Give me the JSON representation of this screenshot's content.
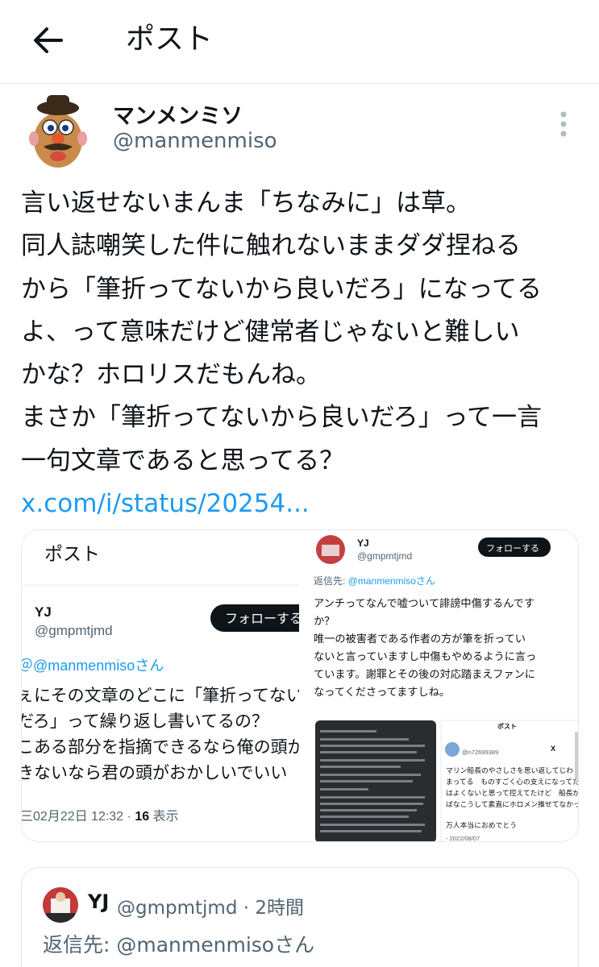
{
  "header": {
    "title": "ポスト",
    "back_icon": "arrow-left-icon"
  },
  "author": {
    "display_name": "マンメンミソ",
    "handle": "@manmenmiso",
    "more_icon": "more-vertical-icon"
  },
  "tweet": {
    "lines": [
      "言い返せないまんま「ちなみに」は草。",
      "同人誌嘲笑した件に触れないままダダ捏ねる",
      "から「筆折ってないから良いだろ」になってる",
      "よ、って意味だけど健常者じゃないと難しい",
      "かな？ホロリスだもんね。",
      "まさか「筆折ってないから良いだろ」って一言",
      "一句文章であると思ってる？"
    ],
    "link": "x.com/i/status/20254..."
  },
  "media": {
    "left": {
      "header_title": "ポスト",
      "name": "YJ",
      "handle": "@gmpmtjmd",
      "follow_label": "フォローする",
      "reply_to": "＠@manmenmisoさん",
      "body_lines": [
        "ぇにその文章のどこに「筆折ってない",
        "だろ」って繰り返し書いてるの？",
        "こある部分を指摘できるなら俺の頭が",
        "きないなら君の頭がおかしいでいい"
      ],
      "meta_time": "三02月22日 12:32 · ",
      "meta_views": "16",
      "meta_views_label": " 表示"
    },
    "right": {
      "name": "YJ",
      "handle": "@gmpmtjmd",
      "follow_label": "フォローする",
      "reply_prefix": "返信先: ",
      "reply_to": "@manmenmisoさん",
      "body_lines": [
        "アンチってなんで嘘ついて誹謗中傷するんです",
        "か？",
        "唯一の被害者である作者の方が筆を折ってい",
        "ないと言っていますし中傷もやめるように言っ",
        "ています。謝罪とその後の対応踏まえファンに",
        "なってくださってますしね。"
      ],
      "inner_card_title": "ポスト",
      "inner_card_handle": "@n72699389",
      "inner_card_lines": [
        "マリン船長のやさしさを思い返してじわし",
        "まってる　ものすごく心の支えになってた",
        "はよくないと思って控えてたけど　船長がいし",
        "ばなこうして素直にホロメン推せてなかった",
        "",
        "万人本当におめでとう"
      ],
      "inner_card_date": "- 2022/08/07"
    }
  },
  "quote": {
    "name": "YJ",
    "handle_time": "@gmpmtjmd · 2時間",
    "reply_prefix": "返信先: ",
    "reply_to": "@manmenmisoさん"
  },
  "colors": {
    "accent": "#1d9bf0",
    "text": "#0f1419",
    "secondary": "#536471",
    "border": "#e6e9ec"
  }
}
